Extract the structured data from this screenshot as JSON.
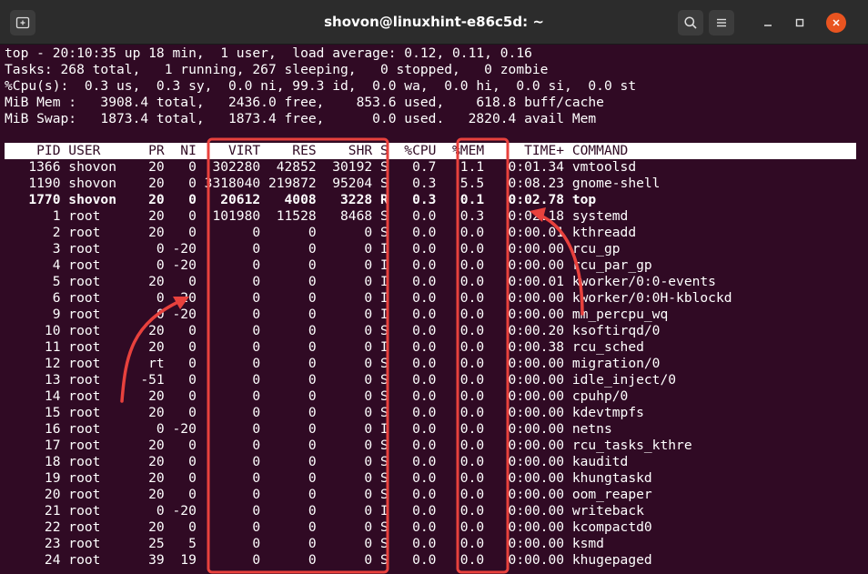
{
  "window": {
    "title": "shovon@linuxhint-e86c5d: ~",
    "new_tab_icon": "new-tab-icon",
    "search_icon": "search-icon",
    "menu_icon": "hamburger-menu-icon",
    "minimize_icon": "minimize-icon",
    "maximize_icon": "maximize-icon",
    "close_icon": "close-icon"
  },
  "summary": {
    "line1": "top - 20:10:35 up 18 min,  1 user,  load average: 0.12, 0.11, 0.16",
    "line2": "Tasks: 268 total,   1 running, 267 sleeping,   0 stopped,   0 zombie",
    "line3": "%Cpu(s):  0.3 us,  0.3 sy,  0.0 ni, 99.3 id,  0.0 wa,  0.0 hi,  0.0 si,  0.0 st",
    "line4": "MiB Mem :   3908.4 total,   2436.0 free,    853.6 used,    618.8 buff/cache",
    "line5": "MiB Swap:   1873.4 total,   1873.4 free,      0.0 used.   2820.4 avail Mem"
  },
  "table": {
    "header": "    PID USER      PR  NI    VIRT    RES    SHR S  %CPU  %MEM     TIME+ COMMAND",
    "rows": [
      "   1366 shovon    20   0  302280  42852  30192 S   0.7   1.1   0:01.34 vmtoolsd",
      "   1190 shovon    20   0 3318040 219872  95204 S   0.3   5.5   0:08.23 gnome-shell",
      "   1770 shovon    20   0   20612   4008   3228 R   0.3   0.1   0:02.78 top",
      "      1 root      20   0  101980  11528   8468 S   0.0   0.3   0:02.18 systemd",
      "      2 root      20   0       0      0      0 S   0.0   0.0   0:00.01 kthreadd",
      "      3 root       0 -20       0      0      0 I   0.0   0.0   0:00.00 rcu_gp",
      "      4 root       0 -20       0      0      0 I   0.0   0.0   0:00.00 rcu_par_gp",
      "      5 root      20   0       0      0      0 I   0.0   0.0   0:00.01 kworker/0:0-events",
      "      6 root       0 -20       0      0      0 I   0.0   0.0   0:00.00 kworker/0:0H-kblockd",
      "      9 root       0 -20       0      0      0 I   0.0   0.0   0:00.00 mm_percpu_wq",
      "     10 root      20   0       0      0      0 S   0.0   0.0   0:00.20 ksoftirqd/0",
      "     11 root      20   0       0      0      0 I   0.0   0.0   0:00.38 rcu_sched",
      "     12 root      rt   0       0      0      0 S   0.0   0.0   0:00.00 migration/0",
      "     13 root     -51   0       0      0      0 S   0.0   0.0   0:00.00 idle_inject/0",
      "     14 root      20   0       0      0      0 S   0.0   0.0   0:00.00 cpuhp/0",
      "     15 root      20   0       0      0      0 S   0.0   0.0   0:00.00 kdevtmpfs",
      "     16 root       0 -20       0      0      0 I   0.0   0.0   0:00.00 netns",
      "     17 root      20   0       0      0      0 S   0.0   0.0   0:00.00 rcu_tasks_kthre",
      "     18 root      20   0       0      0      0 S   0.0   0.0   0:00.00 kauditd",
      "     19 root      20   0       0      0      0 S   0.0   0.0   0:00.00 khungtaskd",
      "     20 root      20   0       0      0      0 S   0.0   0.0   0:00.00 oom_reaper",
      "     21 root       0 -20       0      0      0 I   0.0   0.0   0:00.00 writeback",
      "     22 root      20   0       0      0      0 S   0.0   0.0   0:00.00 kcompactd0",
      "     23 root      25   5       0      0      0 S   0.0   0.0   0:00.00 ksmd",
      "     24 root      39  19       0      0      0 S   0.0   0.0   0:00.00 khugepaged"
    ],
    "bold_row_index": 2
  },
  "colors": {
    "terminal_bg": "#300a24",
    "text": "#ffffff",
    "annotation": "#e8413d",
    "close_button": "#e95420"
  }
}
